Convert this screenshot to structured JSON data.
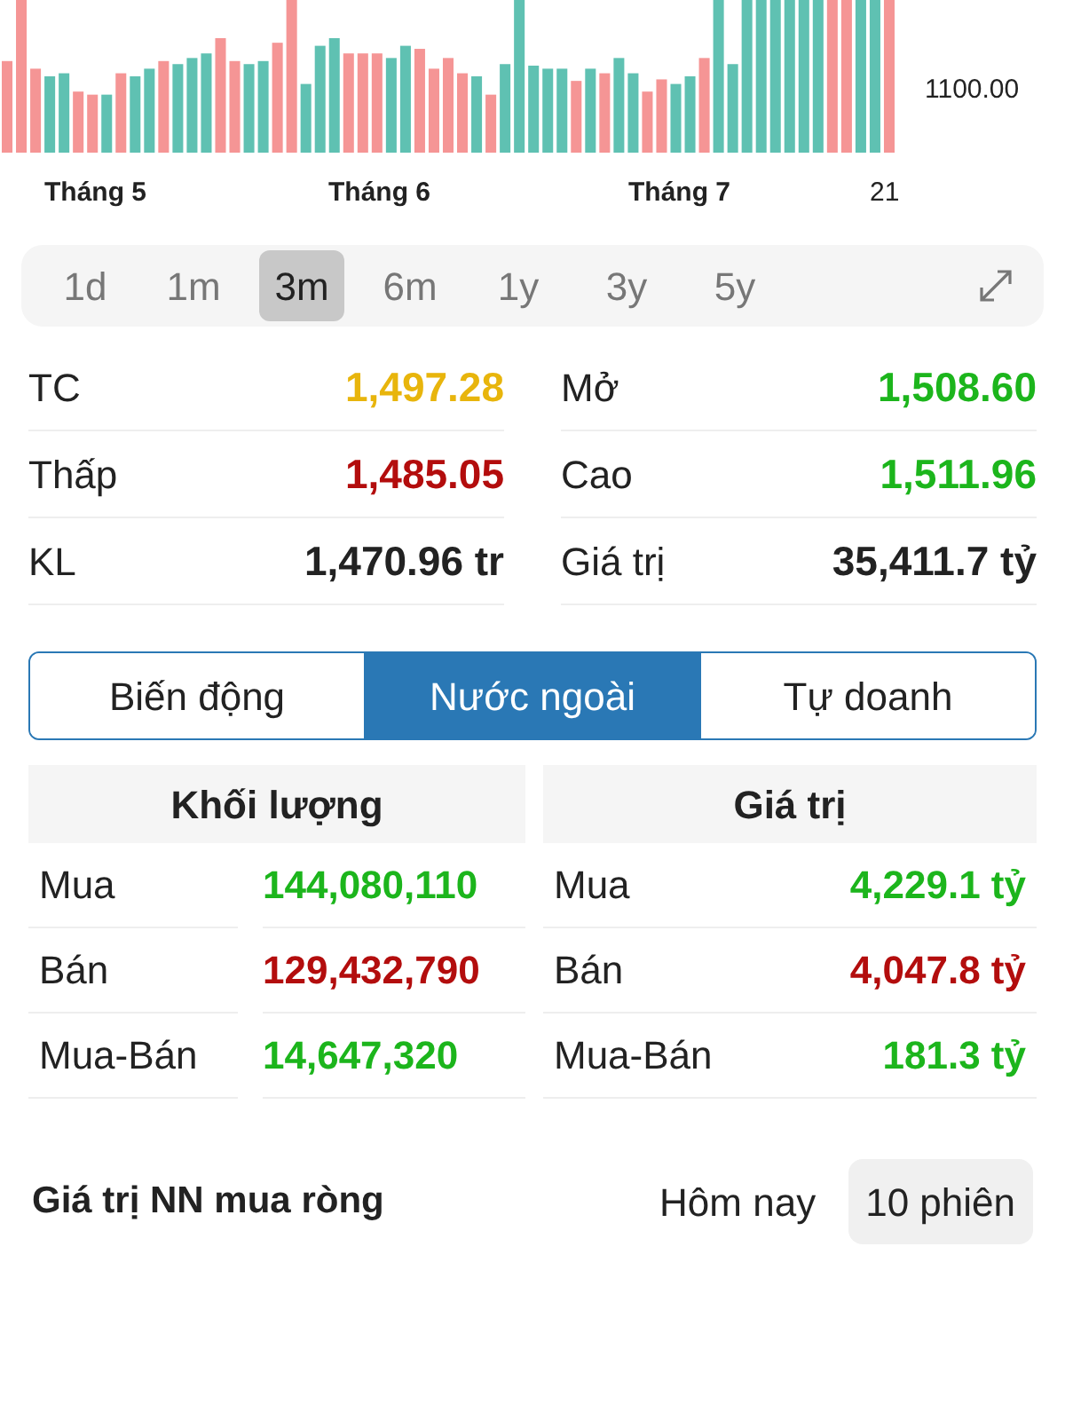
{
  "chart": {
    "y_label": "1100.00",
    "x_labels": [
      "Tháng 5",
      "Tháng 6",
      "Tháng 7",
      "21"
    ]
  },
  "periods": [
    {
      "label": "1d",
      "selected": false
    },
    {
      "label": "1m",
      "selected": false
    },
    {
      "label": "3m",
      "selected": true
    },
    {
      "label": "6m",
      "selected": false
    },
    {
      "label": "1y",
      "selected": false
    },
    {
      "label": "3y",
      "selected": false
    },
    {
      "label": "5y",
      "selected": false
    }
  ],
  "stats": [
    {
      "label": "TC",
      "value": "1,497.28",
      "color": "#e8b50c"
    },
    {
      "label": "Mở",
      "value": "1,508.60",
      "color": "#1cb51c"
    },
    {
      "label": "Thấp",
      "value": "1,485.05",
      "color": "#b30d0d"
    },
    {
      "label": "Cao",
      "value": "1,511.96",
      "color": "#1cb51c"
    },
    {
      "label": "KL",
      "value": "1,470.96 tr",
      "color": "#222222"
    },
    {
      "label": "Giá trị",
      "value": "35,411.7 tỷ",
      "color": "#222222"
    }
  ],
  "segments": [
    {
      "label": "Biến động",
      "selected": false
    },
    {
      "label": "Nước ngoài",
      "selected": true
    },
    {
      "label": "Tự doanh",
      "selected": false
    }
  ],
  "volume": {
    "title": "Khối lượng",
    "labels": [
      "Mua",
      "Bán",
      "Mua-Bán"
    ],
    "values": [
      {
        "text": "144,080,110",
        "color": "#1cb51c"
      },
      {
        "text": "129,432,790",
        "color": "#b30d0d"
      },
      {
        "text": "14,647,320",
        "color": "#1cb51c"
      }
    ]
  },
  "value": {
    "title": "Giá trị",
    "rows": [
      {
        "label": "Mua",
        "value": "4,229.1 tỷ",
        "color": "#1cb51c"
      },
      {
        "label": "Bán",
        "value": "4,047.8 tỷ",
        "color": "#b30d0d"
      },
      {
        "label": "Mua-Bán",
        "value": "181.3 tỷ",
        "color": "#1cb51c"
      }
    ]
  },
  "net_buy": {
    "title": "Giá trị NN mua ròng",
    "options": [
      {
        "label": "Hôm nay",
        "selected": false
      },
      {
        "label": "10 phiên",
        "selected": true
      }
    ]
  }
}
